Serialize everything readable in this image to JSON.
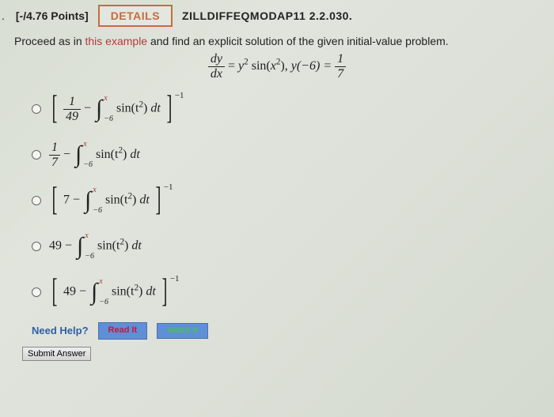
{
  "header": {
    "bullet": ".",
    "points": "[-/4.76 Points]",
    "details_label": "DETAILS",
    "question_id": "ZILLDIFFEQMODAP11 2.2.030."
  },
  "prompt": {
    "before": "Proceed as in ",
    "link": "this example",
    "after": " and find an explicit solution of the given initial-value problem."
  },
  "equation": {
    "lhs_num": "dy",
    "lhs_den": "dx",
    "eq1": " = ",
    "y": "y",
    "sin": " sin(",
    "x": "x",
    "close_comma": "),   ",
    "y_ic": "y(−6) = ",
    "ic_num": "1",
    "ic_den": "7"
  },
  "options": {
    "integrand": "sin(t",
    "integrand_close": ") ",
    "dt": "dt",
    "lower": "−6",
    "upper": "x",
    "neg1": "−1",
    "o1_frac_num": "1",
    "o1_frac_den": "49",
    "minus": " − ",
    "o2_frac_num": "1",
    "o2_frac_den": "7",
    "o3_lead": "7",
    "o4_lead": "49",
    "o5_lead": "49"
  },
  "help": {
    "label": "Need Help?",
    "read": "Read It",
    "watch": "Watch It"
  },
  "submit": {
    "label": "Submit Answer"
  }
}
